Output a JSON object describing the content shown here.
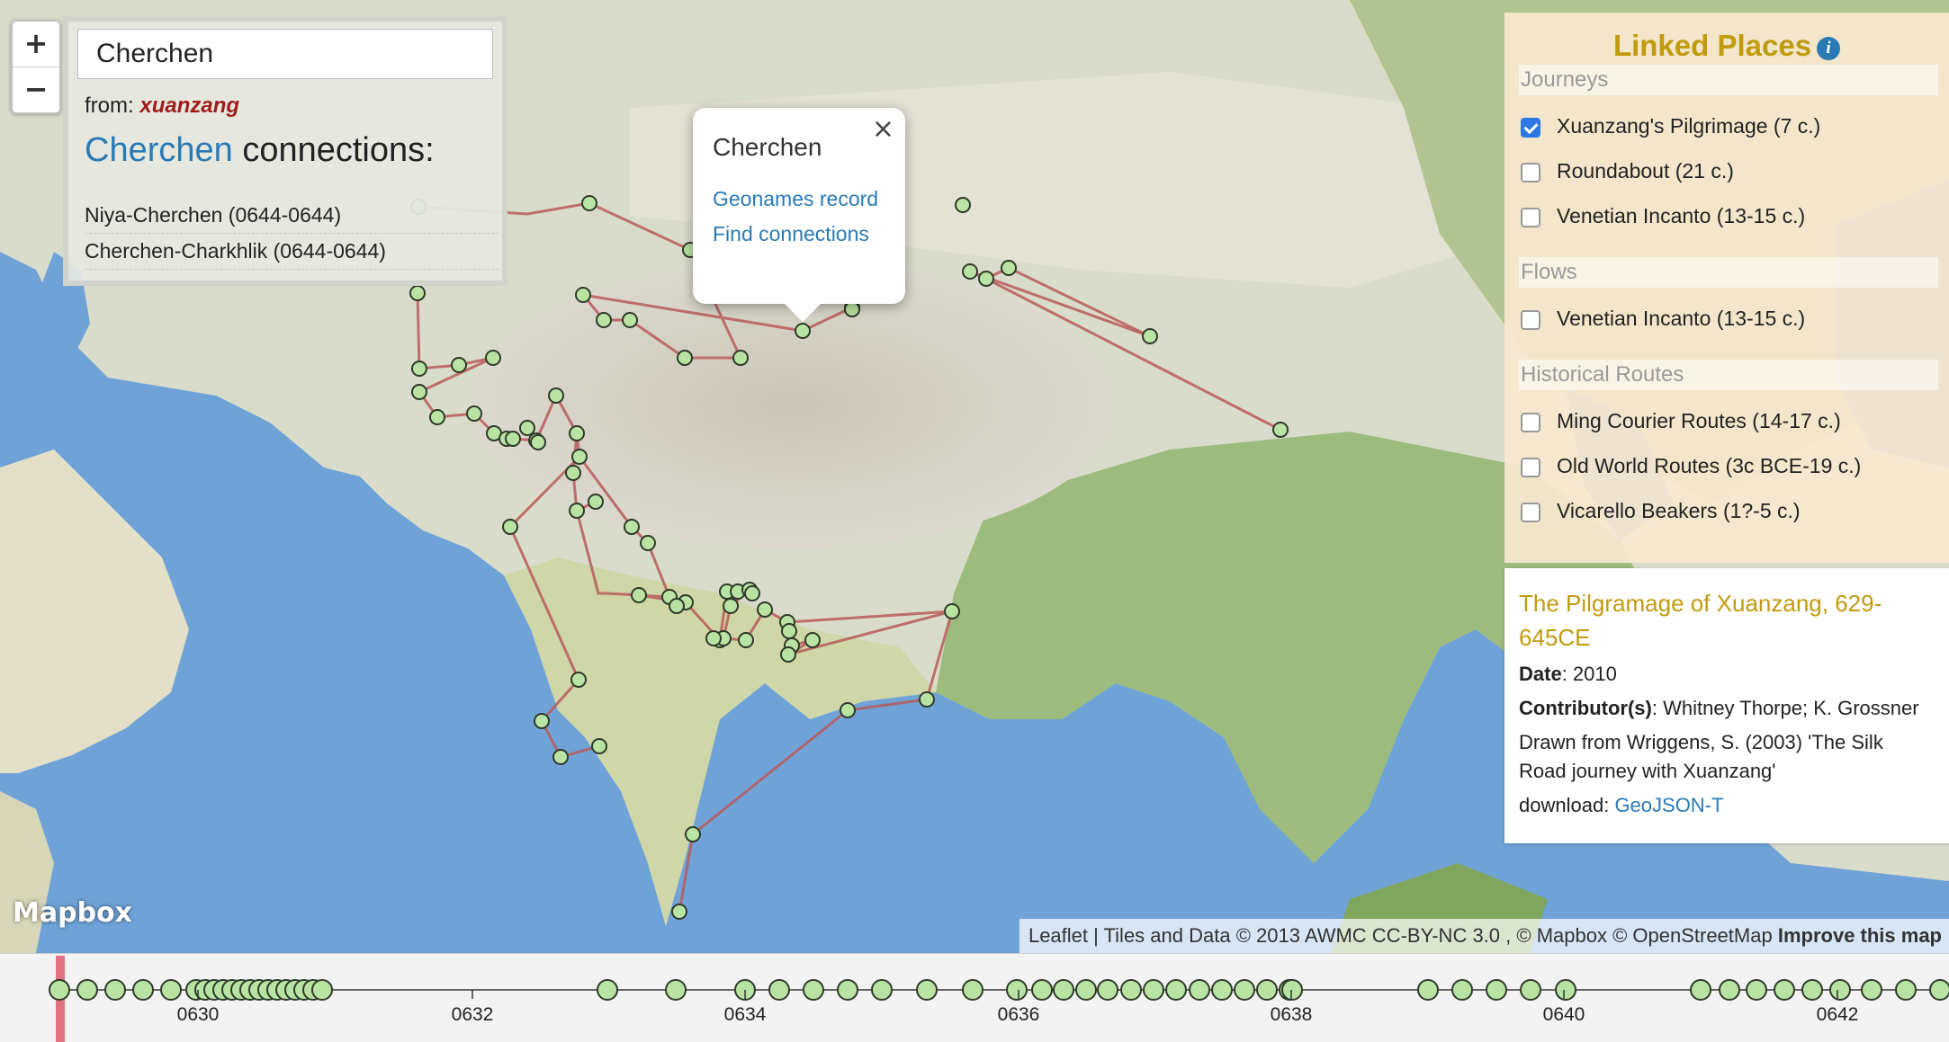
{
  "search": {
    "value": "Cherchen"
  },
  "zoom": {
    "in": "+",
    "out": "−"
  },
  "connections": {
    "from_label": "from:",
    "from_value": "xuanzang",
    "place": "Cherchen",
    "heading_suffix": "connections:",
    "items": [
      "Niya-Cherchen (0644-0644)",
      "Cherchen-Charkhlik (0644-0644)"
    ]
  },
  "popup": {
    "title": "Cherchen",
    "close": "×",
    "links": [
      "Geonames record",
      "Find connections"
    ]
  },
  "sidebar": {
    "title": "Linked Places",
    "info_icon": "i",
    "sections": [
      {
        "heading": "Journeys",
        "items": [
          {
            "label": "Xuanzang's Pilgrimage (7 c.)",
            "checked": true
          },
          {
            "label": "Roundabout (21 c.)",
            "checked": false
          },
          {
            "label": "Venetian Incanto (13-15 c.)",
            "checked": false
          }
        ]
      },
      {
        "heading": "Flows",
        "items": [
          {
            "label": "Venetian Incanto (13-15 c.)",
            "checked": false
          }
        ]
      },
      {
        "heading": "Historical Routes",
        "items": [
          {
            "label": "Ming Courier Routes (14-17 c.)",
            "checked": false
          },
          {
            "label": "Old World Routes (3c BCE-19 c.)",
            "checked": false
          },
          {
            "label": "Vicarello Beakers (1?-5 c.)",
            "checked": false
          }
        ]
      }
    ],
    "description": {
      "title": "The Pilgramage of Xuanzang, 629-645CE",
      "date_label": "Date",
      "date_value": ": 2010",
      "contributors_label": "Contributor(s)",
      "contributors_value": ": Whitney Thorpe; K. Grossner",
      "source": "Drawn from Wriggens, S. (2003) 'The Silk Road journey with Xuanzang'",
      "download_label": "download:",
      "download_link": "GeoJSON-T"
    }
  },
  "map": {
    "logo": "Mapbox",
    "attribution_plain": "Leaflet | Tiles and Data © 2013 AWMC CC-BY-NC 3.0 , © Mapbox © OpenStreetMap",
    "attribution_bold": "Improve this map",
    "colors": {
      "route": "#b85a5a",
      "node_fill": "#b9e3a3",
      "node_stroke": "#2f3a2a",
      "water": "#6fa3d8"
    }
  },
  "timeline": {
    "tick_labels": [
      "0630",
      "0632",
      "0634",
      "0636",
      "0638",
      "0640",
      "0642"
    ]
  }
}
